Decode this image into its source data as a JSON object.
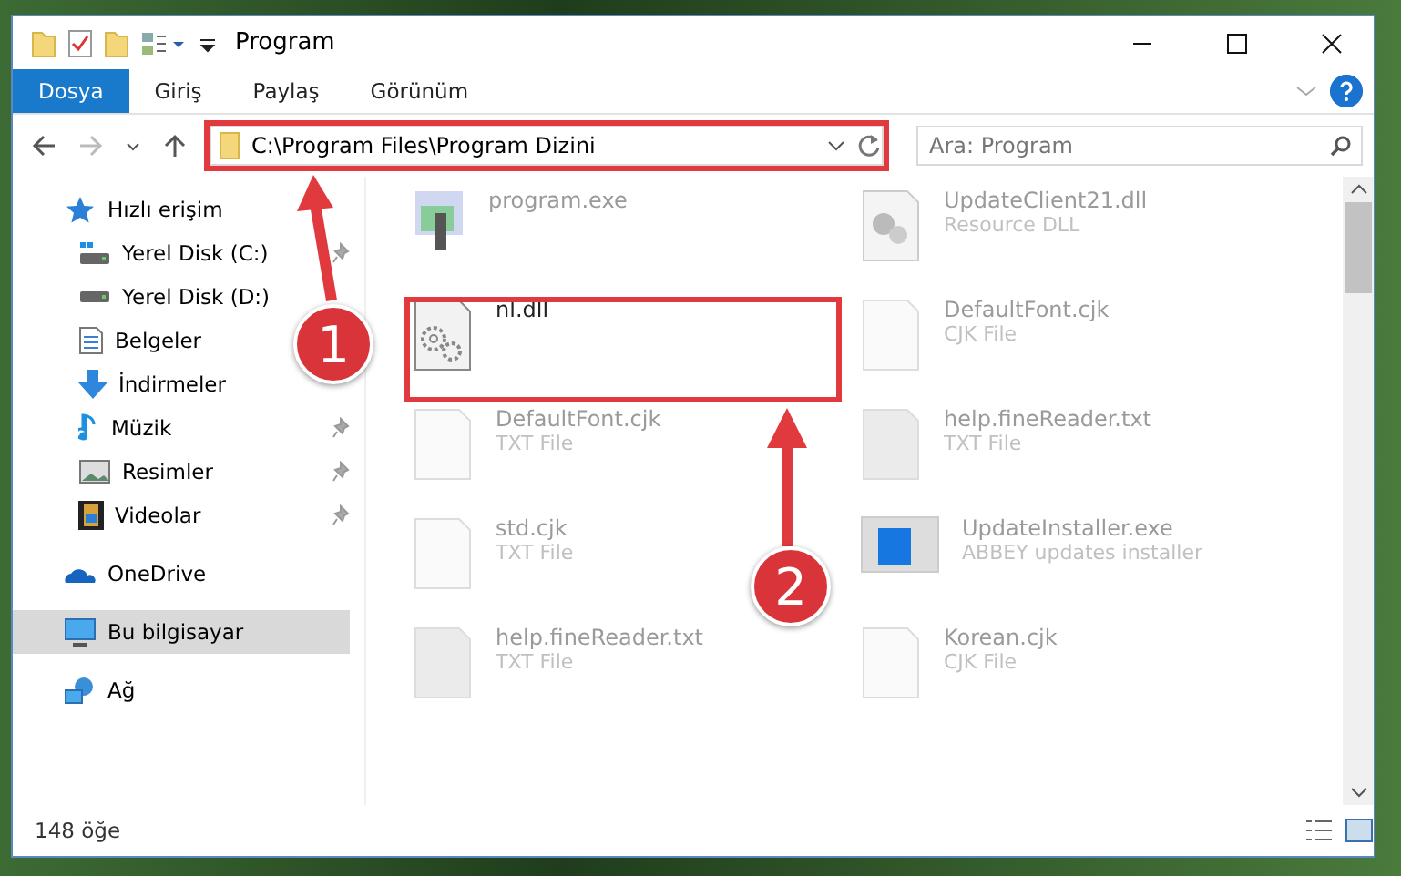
{
  "window": {
    "title": "Program"
  },
  "ribbon_tabs": [
    {
      "label": "Dosya",
      "selected": true
    },
    {
      "label": "Giriş",
      "selected": false
    },
    {
      "label": "Paylaş",
      "selected": false
    },
    {
      "label": "Görünüm",
      "selected": false
    }
  ],
  "address_bar": {
    "path": "C:\\Program Files\\Program Dizini"
  },
  "search": {
    "placeholder": "Ara: Program"
  },
  "sidebar": {
    "items": [
      {
        "label": "Hızlı erişim",
        "selected": false,
        "children": [
          {
            "label": "Yerel Disk (C:)",
            "selected": false,
            "pinned": true
          },
          {
            "label": "Yerel Disk (D:)",
            "selected": false,
            "pinned": false
          },
          {
            "label": "Belgeler",
            "selected": false,
            "pinned": false
          },
          {
            "label": "İndirmeler",
            "selected": false,
            "pinned": false
          },
          {
            "label": "Müzik",
            "selected": false,
            "pinned": true
          },
          {
            "label": "Resimler",
            "selected": false,
            "pinned": true
          },
          {
            "label": "Videolar",
            "selected": false,
            "pinned": true
          }
        ]
      },
      {
        "label": "OneDrive",
        "selected": false
      },
      {
        "label": "Bu bilgisayar",
        "selected": true
      },
      {
        "label": "Ağ",
        "selected": false
      }
    ]
  },
  "files": [
    {
      "name": "program.exe",
      "kind": "exe",
      "faded": true
    },
    {
      "name": "UpdateClient21.dll",
      "type": "Resource DLL",
      "kind": "dll",
      "faded": true
    },
    {
      "name": "nl.dll",
      "kind": "gear",
      "faded": false
    },
    {
      "name": "DefaultFont.cjk",
      "type": "CJK File",
      "kind": "blank",
      "faded": true
    },
    {
      "name": "DefaultFont.cjk",
      "type": "TXT File",
      "kind": "blank",
      "faded": true
    },
    {
      "name": "help.fineReader.txt",
      "type": "TXT File",
      "kind": "grey",
      "faded": true
    },
    {
      "name": "std.cjk",
      "type": "TXT File",
      "kind": "blank",
      "faded": true
    },
    {
      "name": "UpdateInstaller.exe",
      "type": "ABBEY updates installer",
      "kind": "installer",
      "faded": true
    },
    {
      "name": "help.fineReader.txt",
      "type": "TXT File",
      "kind": "grey",
      "faded": true
    },
    {
      "name": "Korean.cjk",
      "type": "CJK File",
      "kind": "blank",
      "faded": true
    }
  ],
  "status_bar": {
    "count": "148 öğe"
  },
  "annotations": [
    {
      "number": "1"
    },
    {
      "number": "2"
    }
  ]
}
